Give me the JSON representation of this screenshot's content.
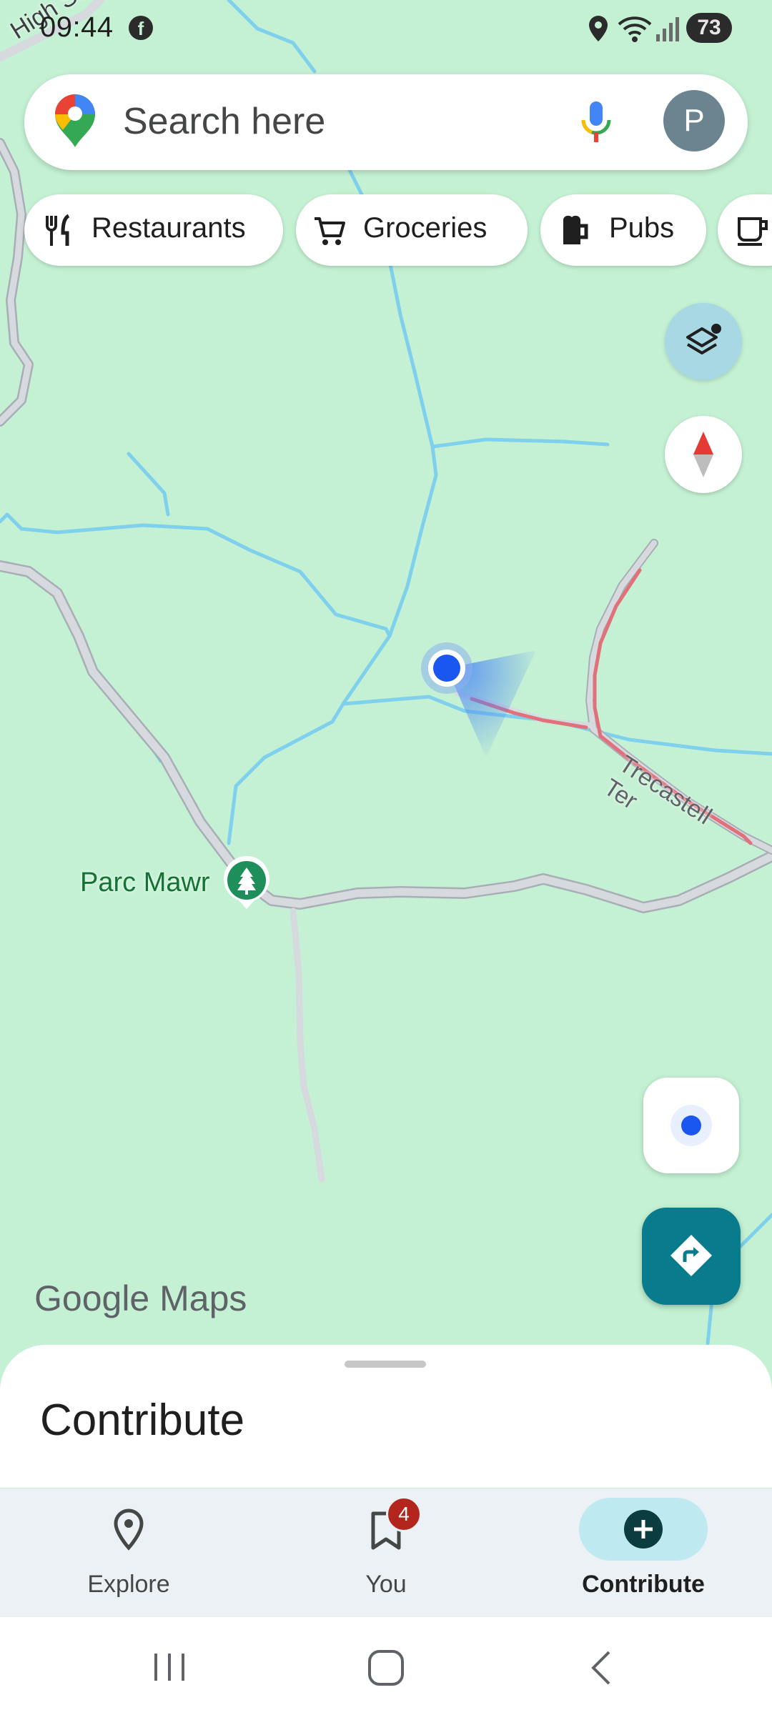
{
  "status_bar": {
    "time": "09:44",
    "battery": "73",
    "icons": [
      "facebook-icon",
      "location-icon",
      "wifi-icon",
      "signal-icon",
      "battery-icon"
    ]
  },
  "search": {
    "placeholder": "Search here",
    "avatar_initial": "P",
    "icons": [
      "maps-pin-logo",
      "mic-icon"
    ]
  },
  "chips": [
    {
      "label": "Restaurants",
      "icon": "fork-knife-icon"
    },
    {
      "label": "Groceries",
      "icon": "shopping-cart-icon"
    },
    {
      "label": "Pubs",
      "icon": "beer-mug-icon"
    },
    {
      "label": "",
      "icon": "coffee-cup-icon"
    }
  ],
  "map": {
    "labels": {
      "street_high": "High St",
      "street_trecastell": "Trecastell Ter",
      "park": "Parc Mawr"
    },
    "watermark_google": "Google",
    "watermark_maps": "Maps",
    "colors": {
      "land": "#c4f1d3",
      "water": "#7fd0ec",
      "road": "#d6d9de",
      "traffic": "#e0707a",
      "location": "#1a56f0",
      "park_pin": "#1e8e5a",
      "directions": "#087c8c"
    }
  },
  "sheet": {
    "title": "Contribute"
  },
  "bottom_nav": {
    "items": [
      {
        "label": "Explore",
        "icon": "location-pin-icon",
        "active": false
      },
      {
        "label": "You",
        "icon": "bookmark-icon",
        "active": false,
        "badge": "4"
      },
      {
        "label": "Contribute",
        "icon": "add-circle-icon",
        "active": true
      }
    ]
  },
  "system_nav": [
    "recents-icon",
    "home-icon",
    "back-icon"
  ]
}
